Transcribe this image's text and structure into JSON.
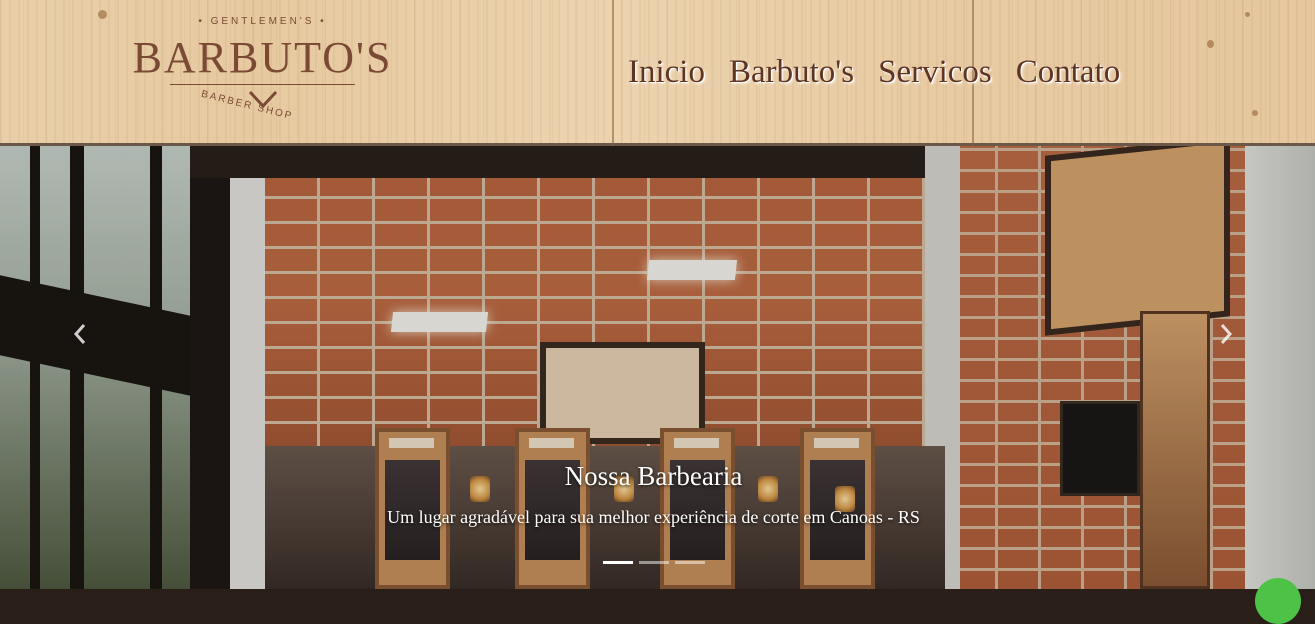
{
  "header": {
    "logo": {
      "top_text": "• GENTLEMEN'S •",
      "brand": "BARBUTO'S",
      "sub_text": "BARBER SHOP"
    },
    "nav": [
      "Inicio",
      "Barbuto's",
      "Servicos",
      "Contato"
    ]
  },
  "carousel": {
    "slide": {
      "title": "Nossa Barbearia",
      "text": "Um lugar agradável para sua melhor experiência de corte em Canoas - RS"
    },
    "prev_icon": "chevron-left-icon",
    "next_icon": "chevron-right-icon",
    "indicator_count": 3,
    "active_indicator": 1
  },
  "chat_widget": {
    "icon": "whatsapp-icon",
    "color": "#4dc247"
  },
  "colors": {
    "brand": "#7a4a34",
    "nav_text": "#5e3424",
    "header_wood": "#e8cba3"
  }
}
